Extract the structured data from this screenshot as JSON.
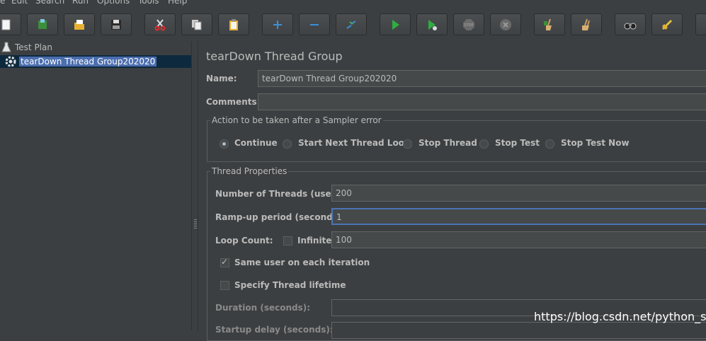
{
  "menu": {
    "items": [
      "e",
      "Edit",
      "Search",
      "Run",
      "Options",
      "Tools",
      "Help"
    ]
  },
  "tree": {
    "root": "Test Plan",
    "child": "tearDown Thread Group202020"
  },
  "panel": {
    "title": "tearDown Thread Group",
    "name_label": "Name:",
    "name_value": "tearDown Thread Group202020",
    "comments_label": "Comments:",
    "comments_value": "",
    "sampler_error": {
      "legend": "Action to be taken after a Sampler error",
      "options": [
        "Continue",
        "Start Next Thread Loop",
        "Stop Thread",
        "Stop Test",
        "Stop Test Now"
      ],
      "selected": "Continue"
    },
    "thread_props": {
      "legend": "Thread Properties",
      "threads_label": "Number of Threads (users):",
      "threads_value": "200",
      "rampup_label": "Ramp-up period (seconds):",
      "rampup_value": "1",
      "loop_label": "Loop Count:",
      "infinite_label": "Infinite",
      "infinite_checked": false,
      "loop_value": "100",
      "same_user_label": "Same user on each iteration",
      "same_user_checked": true,
      "lifetime_label": "Specify Thread lifetime",
      "lifetime_checked": false,
      "duration_label": "Duration (seconds):",
      "duration_value": "",
      "startup_label": "Startup delay (seconds):",
      "startup_value": ""
    }
  },
  "watermark": "https://blog.csdn.net/python_start",
  "toolbar": {
    "icons": [
      "new-icon",
      "templates-icon",
      "open-icon",
      "save-icon",
      "cut-icon",
      "copy-icon",
      "paste-icon",
      "expand-icon",
      "collapse-icon",
      "toggle-icon",
      "start-icon",
      "start-no-pauses-icon",
      "stop-icon",
      "shutdown-icon",
      "clear-icon",
      "clear-all-icon",
      "search-icon",
      "reset-search-icon",
      "more-icon"
    ]
  }
}
